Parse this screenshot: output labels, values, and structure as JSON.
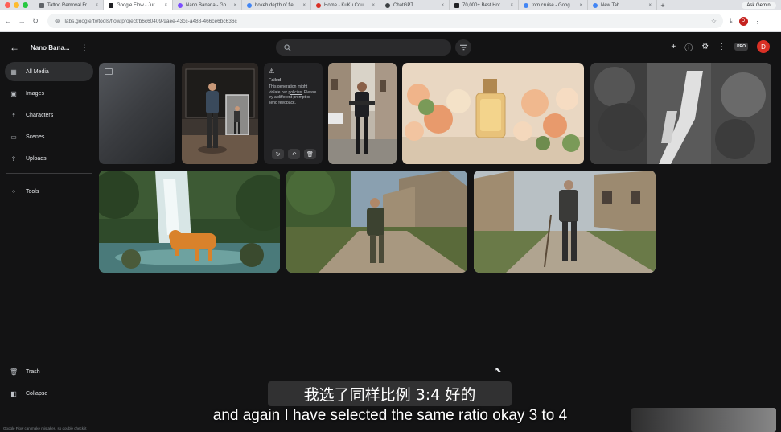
{
  "browser": {
    "tabs": [
      {
        "label": "Tattoo Removal Fr",
        "active": false
      },
      {
        "label": "Google Flow - Jur",
        "active": true
      },
      {
        "label": "Nano Banana - Go",
        "active": false
      },
      {
        "label": "bokeh depth of fie",
        "active": false
      },
      {
        "label": "Home - KuKu Cou",
        "active": false
      },
      {
        "label": "ChatGPT",
        "active": false
      },
      {
        "label": "70,000+ Best Hor",
        "active": false
      },
      {
        "label": "tom cruise - Goog",
        "active": false
      },
      {
        "label": "New Tab",
        "active": false
      }
    ],
    "new_tab_symbol": "+",
    "ask_gemini": "Ask Gemini",
    "url": "labs.google/fx/tools/flow/project/b6c60409-9aee-43cc-a488-466ce6bc636c",
    "profile_initial": "D"
  },
  "header": {
    "back_symbol": "←",
    "project_name": "Nano Bana...",
    "pro_badge": "PRO",
    "user_initial": "D"
  },
  "sidebar": {
    "items": [
      {
        "label": "All Media",
        "icon": "all-media-icon",
        "active": true
      },
      {
        "label": "Images",
        "icon": "images-icon",
        "active": false
      },
      {
        "label": "Characters",
        "icon": "characters-icon",
        "active": false
      },
      {
        "label": "Scenes",
        "icon": "scenes-icon",
        "active": false
      },
      {
        "label": "Uploads",
        "icon": "uploads-icon",
        "active": false
      }
    ],
    "tools_label": "Tools",
    "trash_label": "Trash",
    "collapse_label": "Collapse"
  },
  "failed_tile": {
    "title": "Failed",
    "message_before": "This generation might violate our",
    "policies_link": "policies",
    "message_after": ". Please try a different prompt or send feedback."
  },
  "disclaimer": "Google Flow can make mistakes, so double check it",
  "subtitles": {
    "chinese": "我选了同样比例 3:4 好的",
    "english": "and again I have selected the same ratio okay 3 to 4"
  }
}
